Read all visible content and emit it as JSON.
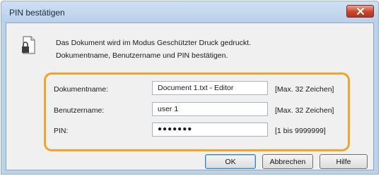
{
  "window": {
    "title": "PIN bestätigen"
  },
  "message": {
    "line1": "Das Dokument wird im Modus Geschützter Druck gedruckt.",
    "line2": "Dokumentname, Benutzername und PIN bestätigen."
  },
  "form": {
    "document_name": {
      "label": "Dokumentname:",
      "value": "Document 1.txt - Editor",
      "hint": "[Max. 32 Zeichen]"
    },
    "user_name": {
      "label": "Benutzername:",
      "value": "user 1",
      "hint": "[Max. 32 Zeichen]"
    },
    "pin": {
      "label": "PIN:",
      "value": "●●●●●●●",
      "hint": "[1 bis 9999999]"
    }
  },
  "buttons": {
    "ok": "OK",
    "cancel": "Abbrechen",
    "help": "Hilfe"
  },
  "icons": {
    "close": "close-icon",
    "document": "document-lock-icon"
  },
  "colors": {
    "highlight": "#f0a42a",
    "close_button": "#c9452c"
  }
}
